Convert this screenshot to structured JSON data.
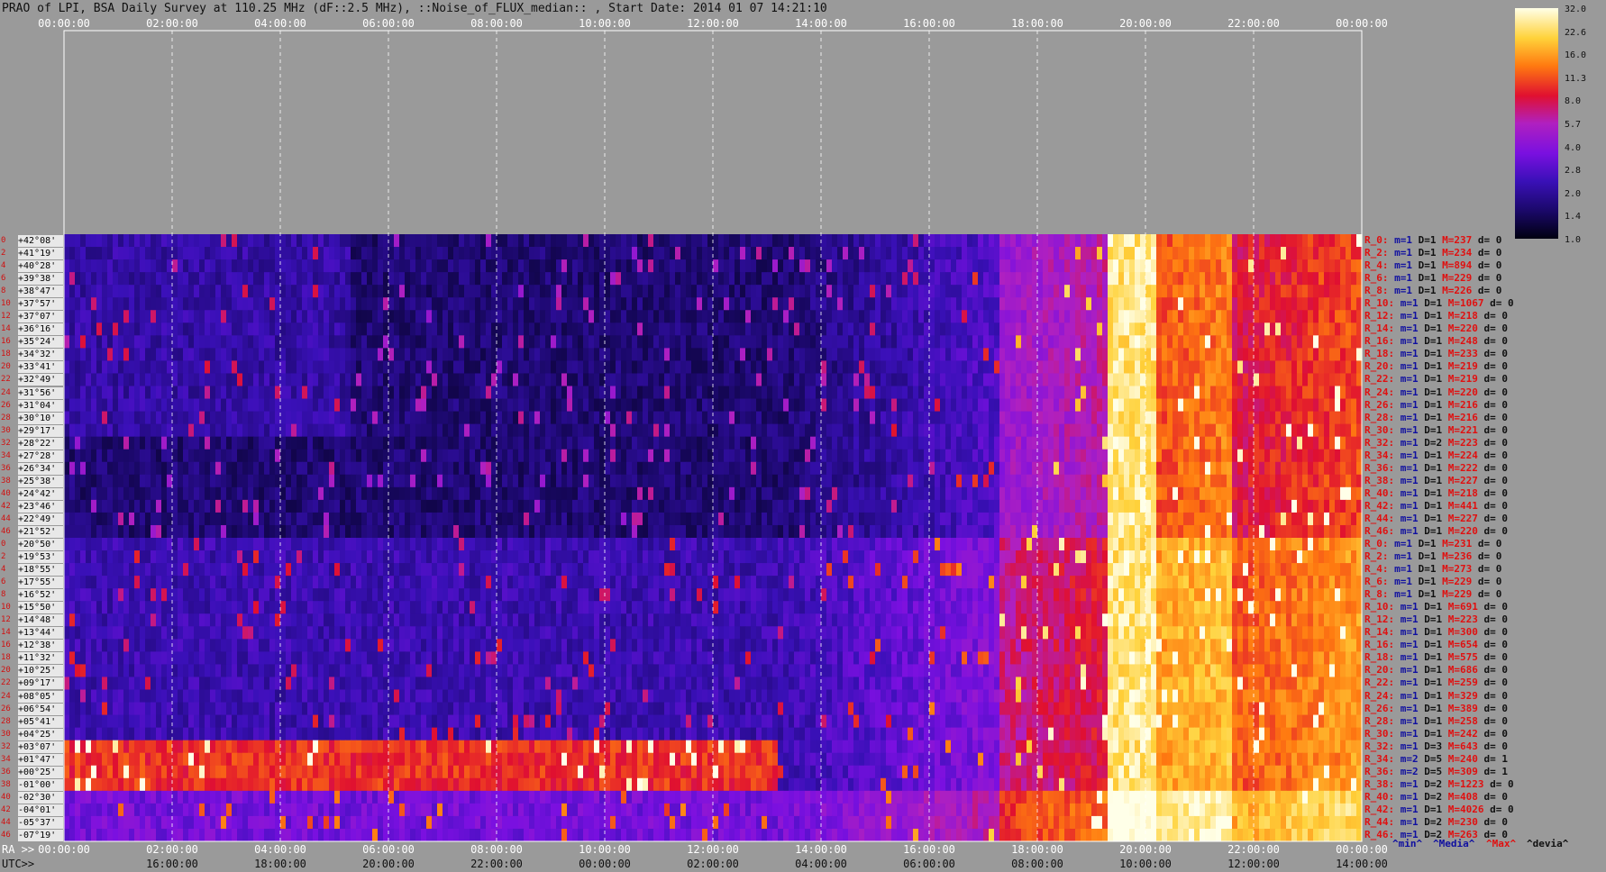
{
  "title": "PRAO of LPI, BSA Daily Survey at 110.25 MHz (dF::2.5 MHz), ::Noise_of_FLUX_median:: , Start Date: 2014 01 07 14:21:10",
  "colors": {
    "background": "#9a9a9a",
    "stat_blue": "#1010a0",
    "stat_red": "#e01010"
  },
  "chart_data": {
    "type": "heatmap",
    "title": "PRAO of LPI, BSA Daily Survey at 110.25 MHz (dF::2.5 MHz), ::Noise_of_FLUX_median:: , Start Date: 2014 01 07 14:21:10",
    "x_top_ticks": [
      "00:00:00",
      "02:00:00",
      "04:00:00",
      "06:00:00",
      "08:00:00",
      "10:00:00",
      "12:00:00",
      "14:00:00",
      "16:00:00",
      "18:00:00",
      "20:00:00",
      "22:00:00",
      "00:00:00"
    ],
    "x_ra_label": "RA >>",
    "x_ra_ticks": [
      "00:00:00",
      "02:00:00",
      "04:00:00",
      "06:00:00",
      "08:00:00",
      "10:00:00",
      "12:00:00",
      "14:00:00",
      "16:00:00",
      "18:00:00",
      "20:00:00",
      "22:00:00",
      "00:00:00"
    ],
    "x_utc_label": "UTC>>",
    "x_utc_ticks": [
      "16:00:00",
      "18:00:00",
      "20:00:00",
      "22:00:00",
      "00:00:00",
      "02:00:00",
      "04:00:00",
      "06:00:00",
      "08:00:00",
      "10:00:00",
      "12:00:00",
      "14:00:00"
    ],
    "colorbar_ticks": [
      "32.0",
      "22.6",
      "16.0",
      "11.3",
      "8.0",
      "5.7",
      "4.0",
      "2.8",
      "2.0",
      "1.4",
      "1.0"
    ],
    "dec_labels": [
      "+42°08'",
      "+41°19'",
      "+40°28'",
      "+39°38'",
      "+38°47'",
      "+37°57'",
      "+37°07'",
      "+36°16'",
      "+35°24'",
      "+34°32'",
      "+33°41'",
      "+32°49'",
      "+31°56'",
      "+31°04'",
      "+30°10'",
      "+29°17'",
      "+28°22'",
      "+27°28'",
      "+26°34'",
      "+25°38'",
      "+24°42'",
      "+23°46'",
      "+22°49'",
      "+21°52'",
      "+20°50'",
      "+19°53'",
      "+18°55'",
      "+17°55'",
      "+16°52'",
      "+15°50'",
      "+14°48'",
      "+13°44'",
      "+12°38'",
      "+11°32'",
      "+10°25'",
      "+09°17'",
      "+08°05'",
      "+06°54'",
      "+05°41'",
      "+04°25'",
      "+03°07'",
      "+01°47'",
      "+00°25'",
      "-01°00'",
      "-02°30'",
      "-04°01'",
      "-05°37'",
      "-07°19'"
    ],
    "row_stats": [
      [
        "R_0:",
        "m=1",
        "D=1",
        "M=237",
        "d= 0"
      ],
      [
        "R_2:",
        "m=1",
        "D=1",
        "M=234",
        "d= 0"
      ],
      [
        "R_4:",
        "m=1",
        "D=1",
        "M=894",
        "d= 0"
      ],
      [
        "R_6:",
        "m=1",
        "D=1",
        "M=229",
        "d= 0"
      ],
      [
        "R_8:",
        "m=1",
        "D=1",
        "M=226",
        "d= 0"
      ],
      [
        "R_10:",
        "m=1",
        "D=1",
        "M=1067",
        "d= 0"
      ],
      [
        "R_12:",
        "m=1",
        "D=1",
        "M=218",
        "d= 0"
      ],
      [
        "R_14:",
        "m=1",
        "D=1",
        "M=220",
        "d= 0"
      ],
      [
        "R_16:",
        "m=1",
        "D=1",
        "M=248",
        "d= 0"
      ],
      [
        "R_18:",
        "m=1",
        "D=1",
        "M=233",
        "d= 0"
      ],
      [
        "R_20:",
        "m=1",
        "D=1",
        "M=219",
        "d= 0"
      ],
      [
        "R_22:",
        "m=1",
        "D=1",
        "M=219",
        "d= 0"
      ],
      [
        "R_24:",
        "m=1",
        "D=1",
        "M=220",
        "d= 0"
      ],
      [
        "R_26:",
        "m=1",
        "D=1",
        "M=216",
        "d= 0"
      ],
      [
        "R_28:",
        "m=1",
        "D=1",
        "M=216",
        "d= 0"
      ],
      [
        "R_30:",
        "m=1",
        "D=1",
        "M=221",
        "d= 0"
      ],
      [
        "R_32:",
        "m=1",
        "D=2",
        "M=223",
        "d= 0"
      ],
      [
        "R_34:",
        "m=1",
        "D=1",
        "M=224",
        "d= 0"
      ],
      [
        "R_36:",
        "m=1",
        "D=1",
        "M=222",
        "d= 0"
      ],
      [
        "R_38:",
        "m=1",
        "D=1",
        "M=227",
        "d= 0"
      ],
      [
        "R_40:",
        "m=1",
        "D=1",
        "M=218",
        "d= 0"
      ],
      [
        "R_42:",
        "m=1",
        "D=1",
        "M=441",
        "d= 0"
      ],
      [
        "R_44:",
        "m=1",
        "D=1",
        "M=227",
        "d= 0"
      ],
      [
        "R_46:",
        "m=1",
        "D=1",
        "M=220",
        "d= 0"
      ],
      [
        "R_0:",
        "m=1",
        "D=1",
        "M=231",
        "d= 0"
      ],
      [
        "R_2:",
        "m=1",
        "D=1",
        "M=236",
        "d= 0"
      ],
      [
        "R_4:",
        "m=1",
        "D=1",
        "M=273",
        "d= 0"
      ],
      [
        "R_6:",
        "m=1",
        "D=1",
        "M=229",
        "d= 0"
      ],
      [
        "R_8:",
        "m=1",
        "D=1",
        "M=229",
        "d= 0"
      ],
      [
        "R_10:",
        "m=1",
        "D=1",
        "M=691",
        "d= 0"
      ],
      [
        "R_12:",
        "m=1",
        "D=1",
        "M=223",
        "d= 0"
      ],
      [
        "R_14:",
        "m=1",
        "D=1",
        "M=300",
        "d= 0"
      ],
      [
        "R_16:",
        "m=1",
        "D=1",
        "M=654",
        "d= 0"
      ],
      [
        "R_18:",
        "m=1",
        "D=1",
        "M=575",
        "d= 0"
      ],
      [
        "R_20:",
        "m=1",
        "D=1",
        "M=686",
        "d= 0"
      ],
      [
        "R_22:",
        "m=1",
        "D=1",
        "M=259",
        "d= 0"
      ],
      [
        "R_24:",
        "m=1",
        "D=1",
        "M=329",
        "d= 0"
      ],
      [
        "R_26:",
        "m=1",
        "D=1",
        "M=389",
        "d= 0"
      ],
      [
        "R_28:",
        "m=1",
        "D=1",
        "M=258",
        "d= 0"
      ],
      [
        "R_30:",
        "m=1",
        "D=1",
        "M=242",
        "d= 0"
      ],
      [
        "R_32:",
        "m=1",
        "D=3",
        "M=643",
        "d= 0"
      ],
      [
        "R_34:",
        "m=2",
        "D=5",
        "M=240",
        "d= 1"
      ],
      [
        "R_36:",
        "m=2",
        "D=5",
        "M=309",
        "d= 1"
      ],
      [
        "R_38:",
        "m=1",
        "D=2",
        "M=1223",
        "d= 0"
      ],
      [
        "R_40:",
        "m=1",
        "D=2",
        "M=408",
        "d= 0"
      ],
      [
        "R_42:",
        "m=1",
        "D=1",
        "M=4026",
        "d= 0"
      ],
      [
        "R_44:",
        "m=1",
        "D=2",
        "M=230",
        "d= 0"
      ],
      [
        "R_46:",
        "m=1",
        "D=2",
        "M=263",
        "d= 0"
      ]
    ],
    "row_indices": [
      "0",
      "2",
      "4",
      "6",
      "8",
      "10",
      "12",
      "14",
      "16",
      "18",
      "20",
      "22",
      "24",
      "26",
      "28",
      "30",
      "32",
      "34",
      "36",
      "38",
      "40",
      "42",
      "44",
      "46",
      "0",
      "2",
      "4",
      "6",
      "8",
      "10",
      "12",
      "14",
      "16",
      "18",
      "20",
      "22",
      "24",
      "26",
      "28",
      "30",
      "32",
      "34",
      "36",
      "38",
      "40",
      "42",
      "44",
      "46"
    ],
    "legend_labels": [
      "^min^",
      "^Media^",
      "^Max^",
      "^devia^"
    ]
  }
}
